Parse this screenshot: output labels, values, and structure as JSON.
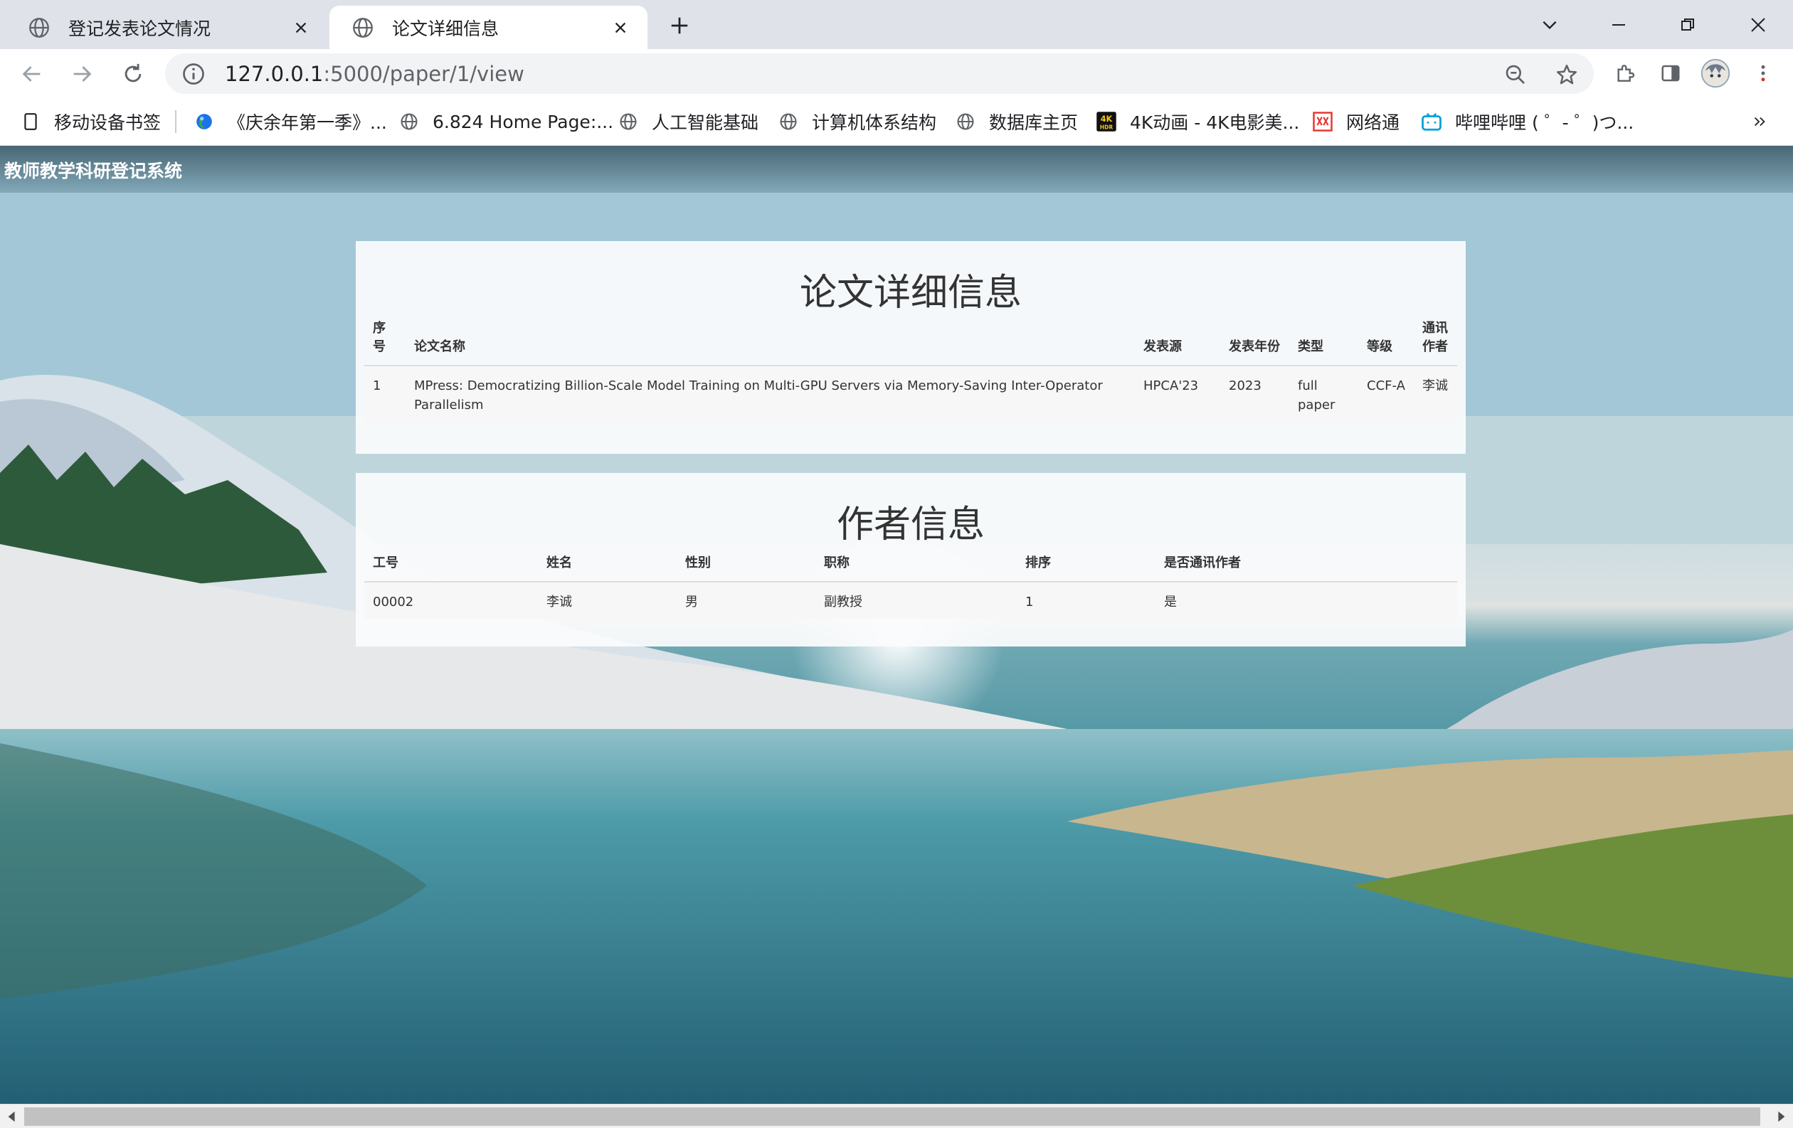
{
  "browser": {
    "tabs": [
      {
        "title": "登记发表论文情况",
        "active": false
      },
      {
        "title": "论文详细信息",
        "active": true
      }
    ],
    "url_host": "127.0.0.1",
    "url_rest": ":5000/paper/1/view",
    "bookmarks": [
      {
        "label": "移动设备书签",
        "icon": "bookmark-outline-icon"
      },
      {
        "label": "《庆余年第一季》...",
        "icon": "earth-favicon-icon"
      },
      {
        "label": "6.824 Home Page:...",
        "icon": "globe-icon"
      },
      {
        "label": "人工智能基础",
        "icon": "globe-icon"
      },
      {
        "label": "计算机体系结构",
        "icon": "globe-icon"
      },
      {
        "label": "数据库主页",
        "icon": "globe-icon"
      },
      {
        "label": "4K动画 - 4K电影美...",
        "icon": "4k-hdr-icon"
      },
      {
        "label": "网络通",
        "icon": "wangluotong-icon"
      },
      {
        "label": "哔哩哔哩 ( ゜- ゜)つ...",
        "icon": "bilibili-icon"
      }
    ]
  },
  "site": {
    "brand": "教师教学科研登记系统"
  },
  "paper_section": {
    "title": "论文详细信息",
    "headers": [
      "序号",
      "论文名称",
      "发表源",
      "发表年份",
      "类型",
      "等级",
      "通讯作者"
    ],
    "rows": [
      [
        "1",
        "MPress: Democratizing Billion-Scale Model Training on Multi-GPU Servers via Memory-Saving Inter-Operator Parallelism",
        "HPCA'23",
        "2023",
        "full paper",
        "CCF-A",
        "李诚"
      ]
    ]
  },
  "author_section": {
    "title": "作者信息",
    "headers": [
      "工号",
      "姓名",
      "性别",
      "职称",
      "排序",
      "是否通讯作者"
    ],
    "rows": [
      [
        "00002",
        "李诚",
        "男",
        "副教授",
        "1",
        "是"
      ]
    ]
  },
  "colors": {
    "tab_strip": "#dfe3e9",
    "card": "#fafbfc",
    "accent_bilibili": "#00a1d6",
    "accent_wlt": "#e53935"
  }
}
